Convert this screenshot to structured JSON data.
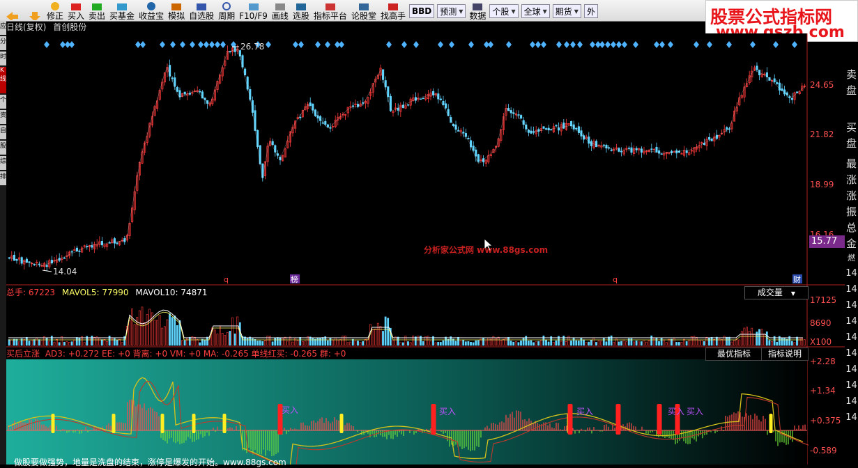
{
  "toolbar": {
    "items": [
      "修正",
      "买入",
      "卖出",
      "买基金",
      "收益宝",
      "模拟",
      "自选股",
      "周期",
      "F10/F9",
      "画线",
      "选股",
      "指标平台",
      "论股堂",
      "找高手",
      "数据"
    ],
    "dropdowns": [
      "BBD",
      "预测",
      "个股",
      "全球",
      "期货",
      "外"
    ]
  },
  "watermark": {
    "line1": "股票公式指标网",
    "line2": "www.gszb.com"
  },
  "chart": {
    "period_label": "日线(复权)",
    "stock_name": "首创股份",
    "high_label": "26.78",
    "low_label": "14.04",
    "price_box": "15.77",
    "center_watermark": "分析家公式网 www.88gs.com",
    "markers": [
      "q",
      "榜",
      "q",
      "财"
    ],
    "y_labels": [
      "24.65",
      "21.82",
      "18.99",
      "16.16"
    ]
  },
  "volume": {
    "total_label": "总手",
    "total_value": "67223",
    "mavol5_label": "MAVOL5",
    "mavol5_value": "77990",
    "mavol10_label": "MAVOL10",
    "mavol10_value": "74871",
    "selector": "成交量",
    "y_labels": [
      "17125",
      "8690",
      "X100"
    ]
  },
  "indicator": {
    "name": "买后立涨",
    "params": "AD3: +0.272  EE: +0  背离: +0  VM: +0  MA: -0.265  单线红买: -0.265  群: +0",
    "btn_best": "最优指标",
    "btn_explain": "指标说明",
    "y_labels": [
      "+2.28",
      "+1.34",
      "+0.375",
      "-0.589"
    ],
    "buy_label": "买入",
    "bottom_text": "做股要做强势，地量是洗盘的结束，涨停是爆发的开始。www.88gs.com"
  },
  "right_panel": [
    "卖",
    "盘",
    "买",
    "盘",
    "最",
    "涨",
    "涨",
    "振",
    "总",
    "金",
    "燃"
  ],
  "right_numbers": [
    "14",
    "14",
    "14",
    "14",
    "14",
    "14",
    "14",
    "14",
    "14",
    "14",
    "14"
  ],
  "left_tabs": [
    "应",
    "用",
    "分",
    "时",
    "图",
    "K线",
    "图",
    "个",
    "股",
    "资",
    "料",
    "自",
    "选",
    "股",
    "综",
    "合",
    "排",
    "名"
  ],
  "colors": {
    "up": "#ff3b3b",
    "down": "#5fd4ff",
    "ma": "#ffffff",
    "accent": "#e8151b"
  }
}
